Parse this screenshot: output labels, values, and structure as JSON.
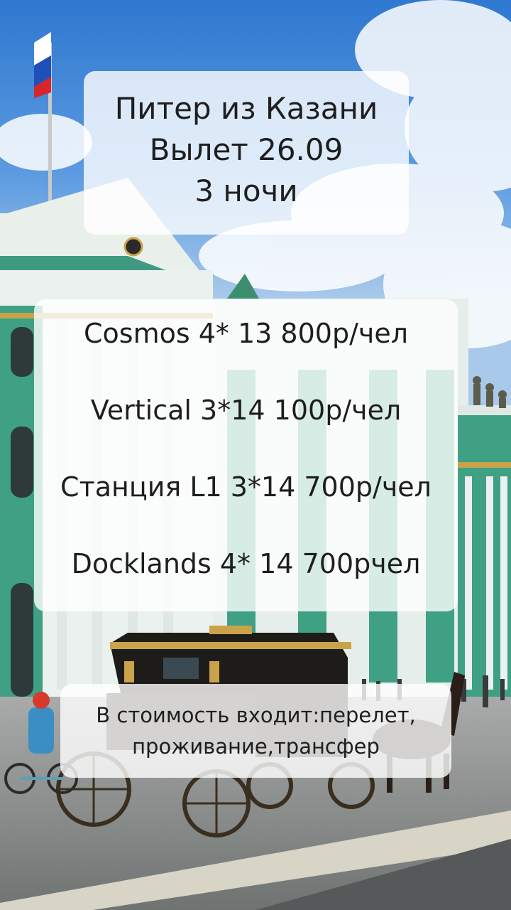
{
  "header": {
    "lines": [
      "Питер из Казани",
      "Вылет 26.09",
      "3 ночи"
    ]
  },
  "prices": [
    "Cosmos 4* 13 800р/чел",
    "Vertical 3*14 100р/чел",
    "Станция L1 3*14 700р/чел",
    "Docklands 4* 14 700рчел"
  ],
  "info": {
    "lines": [
      "В стоимость входит:перелет,",
      "проживание,трансфер"
    ]
  },
  "colors": {
    "sky": "#4f8fd6",
    "building_green": "#4aa38a",
    "building_white": "#eef3f1",
    "gold": "#c9a24a",
    "pavement": "#8f9595",
    "card_bg": "#ffffff",
    "text": "#1e1e1e"
  },
  "icons": [
    "russian-flag-icon",
    "clock-icon",
    "carriage-icon",
    "horse-icon",
    "cyclist-icon"
  ]
}
